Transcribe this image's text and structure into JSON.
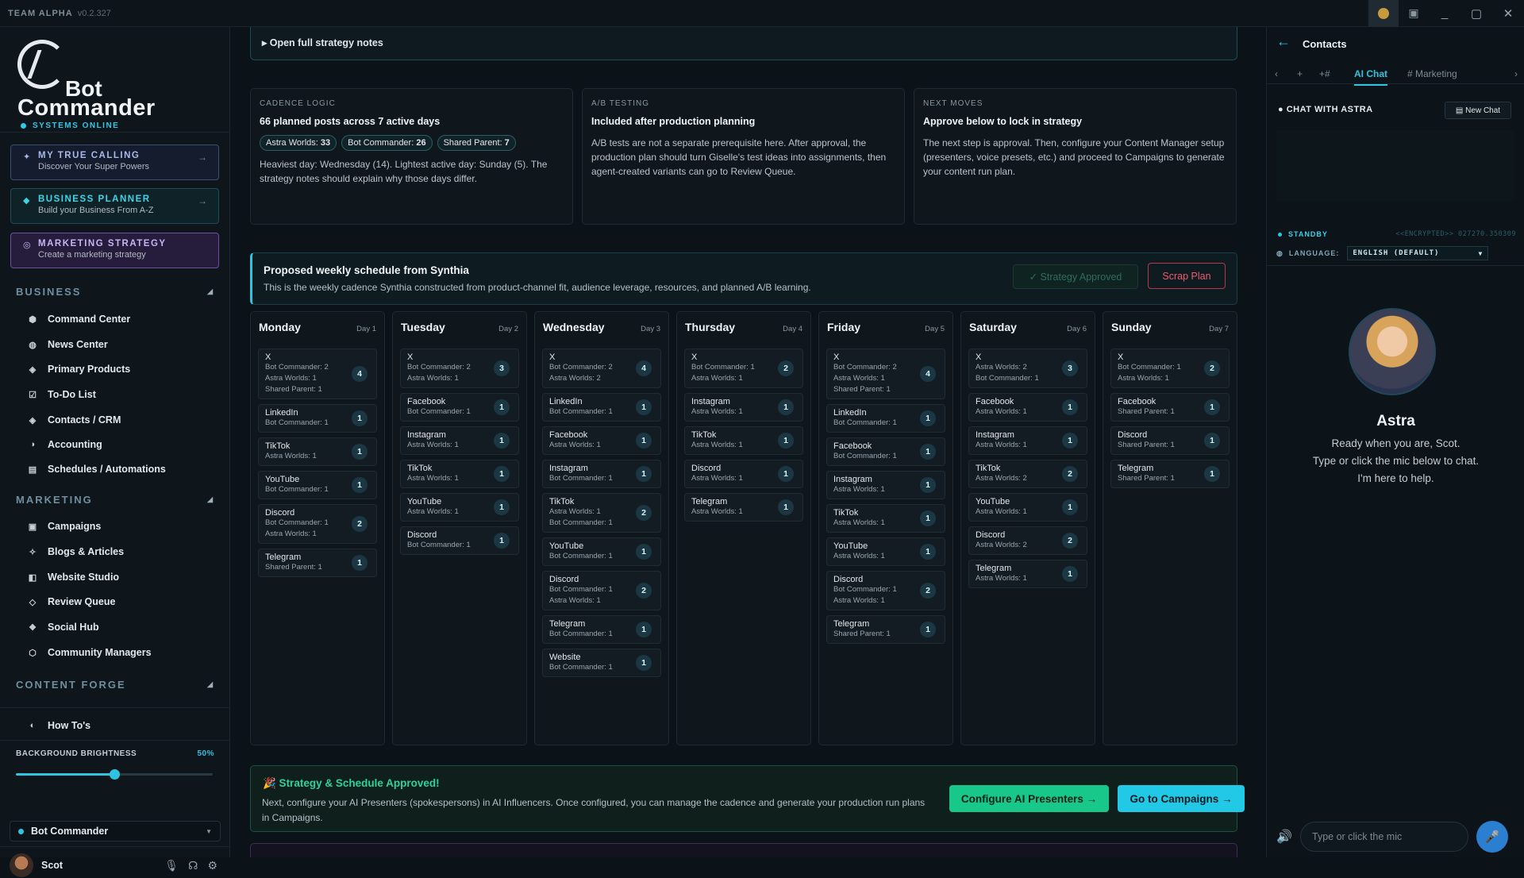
{
  "titlebar": {
    "app": "TEAM ALPHA",
    "version": "v0.2.327"
  },
  "sidebar": {
    "logo_line1": "Bot",
    "logo_line2": "Commander",
    "status": "SYSTEMS ONLINE",
    "ctas": [
      {
        "label": "MY TRUE CALLING",
        "sub": "Discover Your Super Powers"
      },
      {
        "label": "BUSINESS PLANNER",
        "sub": "Build your Business From A-Z"
      },
      {
        "label": "MARKETING STRATEGY",
        "sub": "Create a marketing strategy"
      }
    ],
    "sections": {
      "business": "BUSINESS",
      "marketing": "MARKETING",
      "content_forge": "CONTENT FORGE"
    },
    "business_items": [
      "Command Center",
      "News Center",
      "Primary Products",
      "To-Do List",
      "Contacts / CRM",
      "Accounting",
      "Schedules / Automations"
    ],
    "marketing_items": [
      "Campaigns",
      "Blogs & Articles",
      "Website Studio",
      "Review Queue",
      "Social Hub",
      "Community Managers"
    ],
    "forge_items": [
      "How To's"
    ],
    "brightness_label": "BACKGROUND BRIGHTNESS",
    "brightness_value": "50%",
    "brightness_fraction": 0.5,
    "workspace": "Bot Commander",
    "user": "Scot"
  },
  "main": {
    "notes_toggle": "Open full strategy notes",
    "cards": [
      {
        "kicker": "CADENCE LOGIC",
        "title": "66 planned posts across 7 active days",
        "chips": [
          [
            "Astra Worlds: ",
            "33"
          ],
          [
            "Bot Commander: ",
            "26"
          ],
          [
            "Shared Parent: ",
            "7"
          ]
        ],
        "text": "Heaviest day: Wednesday (14). Lightest active day: Sunday (5). The strategy notes should explain why those days differ."
      },
      {
        "kicker": "A/B TESTING",
        "title": "Included after production planning",
        "text": "A/B tests are not a separate prerequisite here. After approval, the production plan should turn Giselle's test ideas into assignments, then agent-created variants can go to Review Queue."
      },
      {
        "kicker": "NEXT MOVES",
        "title": "Approve below to lock in strategy",
        "text": "The next step is approval. Then, configure your Content Manager setup (presenters, voice presets, etc.) and proceed to Campaigns to generate your content run plan."
      }
    ],
    "schedule_title": "Proposed weekly schedule from Synthia",
    "schedule_sub": "This is the weekly cadence Synthia constructed from product-channel fit, audience leverage, resources, and planned A/B learning.",
    "approved_btn": "✓ Strategy Approved",
    "scrap_btn": "Scrap Plan",
    "days": [
      {
        "name": "Monday",
        "num": "Day 1",
        "posts": [
          {
            "ch": "X",
            "lines": [
              "Bot Commander: 2",
              "Astra Worlds: 1",
              "Shared Parent: 1"
            ],
            "count": "4"
          },
          {
            "ch": "LinkedIn",
            "lines": [
              "Bot Commander: 1"
            ],
            "count": "1"
          },
          {
            "ch": "TikTok",
            "lines": [
              "Astra Worlds: 1"
            ],
            "count": "1"
          },
          {
            "ch": "YouTube",
            "lines": [
              "Bot Commander: 1"
            ],
            "count": "1"
          },
          {
            "ch": "Discord",
            "lines": [
              "Bot Commander: 1",
              "Astra Worlds: 1"
            ],
            "count": "2"
          },
          {
            "ch": "Telegram",
            "lines": [
              "Shared Parent: 1"
            ],
            "count": "1"
          }
        ]
      },
      {
        "name": "Tuesday",
        "num": "Day 2",
        "posts": [
          {
            "ch": "X",
            "lines": [
              "Bot Commander: 2",
              "Astra Worlds: 1"
            ],
            "count": "3"
          },
          {
            "ch": "Facebook",
            "lines": [
              "Bot Commander: 1"
            ],
            "count": "1"
          },
          {
            "ch": "Instagram",
            "lines": [
              "Astra Worlds: 1"
            ],
            "count": "1"
          },
          {
            "ch": "TikTok",
            "lines": [
              "Astra Worlds: 1"
            ],
            "count": "1"
          },
          {
            "ch": "YouTube",
            "lines": [
              "Astra Worlds: 1"
            ],
            "count": "1"
          },
          {
            "ch": "Discord",
            "lines": [
              "Bot Commander: 1"
            ],
            "count": "1"
          }
        ]
      },
      {
        "name": "Wednesday",
        "num": "Day 3",
        "posts": [
          {
            "ch": "X",
            "lines": [
              "Bot Commander: 2",
              "Astra Worlds: 2"
            ],
            "count": "4"
          },
          {
            "ch": "LinkedIn",
            "lines": [
              "Bot Commander: 1"
            ],
            "count": "1"
          },
          {
            "ch": "Facebook",
            "lines": [
              "Astra Worlds: 1"
            ],
            "count": "1"
          },
          {
            "ch": "Instagram",
            "lines": [
              "Bot Commander: 1"
            ],
            "count": "1"
          },
          {
            "ch": "TikTok",
            "lines": [
              "Astra Worlds: 1",
              "Bot Commander: 1"
            ],
            "count": "2"
          },
          {
            "ch": "YouTube",
            "lines": [
              "Bot Commander: 1"
            ],
            "count": "1"
          },
          {
            "ch": "Discord",
            "lines": [
              "Bot Commander: 1",
              "Astra Worlds: 1"
            ],
            "count": "2"
          },
          {
            "ch": "Telegram",
            "lines": [
              "Bot Commander: 1"
            ],
            "count": "1"
          },
          {
            "ch": "Website",
            "lines": [
              "Bot Commander: 1"
            ],
            "count": "1"
          }
        ]
      },
      {
        "name": "Thursday",
        "num": "Day 4",
        "posts": [
          {
            "ch": "X",
            "lines": [
              "Bot Commander: 1",
              "Astra Worlds: 1"
            ],
            "count": "2"
          },
          {
            "ch": "Instagram",
            "lines": [
              "Astra Worlds: 1"
            ],
            "count": "1"
          },
          {
            "ch": "TikTok",
            "lines": [
              "Astra Worlds: 1"
            ],
            "count": "1"
          },
          {
            "ch": "Discord",
            "lines": [
              "Astra Worlds: 1"
            ],
            "count": "1"
          },
          {
            "ch": "Telegram",
            "lines": [
              "Astra Worlds: 1"
            ],
            "count": "1"
          }
        ]
      },
      {
        "name": "Friday",
        "num": "Day 5",
        "posts": [
          {
            "ch": "X",
            "lines": [
              "Bot Commander: 2",
              "Astra Worlds: 1",
              "Shared Parent: 1"
            ],
            "count": "4"
          },
          {
            "ch": "LinkedIn",
            "lines": [
              "Bot Commander: 1"
            ],
            "count": "1"
          },
          {
            "ch": "Facebook",
            "lines": [
              "Bot Commander: 1"
            ],
            "count": "1"
          },
          {
            "ch": "Instagram",
            "lines": [
              "Astra Worlds: 1"
            ],
            "count": "1"
          },
          {
            "ch": "TikTok",
            "lines": [
              "Astra Worlds: 1"
            ],
            "count": "1"
          },
          {
            "ch": "YouTube",
            "lines": [
              "Astra Worlds: 1"
            ],
            "count": "1"
          },
          {
            "ch": "Discord",
            "lines": [
              "Bot Commander: 1",
              "Astra Worlds: 1"
            ],
            "count": "2"
          },
          {
            "ch": "Telegram",
            "lines": [
              "Shared Parent: 1"
            ],
            "count": "1"
          }
        ]
      },
      {
        "name": "Saturday",
        "num": "Day 6",
        "posts": [
          {
            "ch": "X",
            "lines": [
              "Astra Worlds: 2",
              "Bot Commander: 1"
            ],
            "count": "3"
          },
          {
            "ch": "Facebook",
            "lines": [
              "Astra Worlds: 1"
            ],
            "count": "1"
          },
          {
            "ch": "Instagram",
            "lines": [
              "Astra Worlds: 1"
            ],
            "count": "1"
          },
          {
            "ch": "TikTok",
            "lines": [
              "Astra Worlds: 2"
            ],
            "count": "2"
          },
          {
            "ch": "YouTube",
            "lines": [
              "Astra Worlds: 1"
            ],
            "count": "1"
          },
          {
            "ch": "Discord",
            "lines": [
              "Astra Worlds: 2"
            ],
            "count": "2"
          },
          {
            "ch": "Telegram",
            "lines": [
              "Astra Worlds: 1"
            ],
            "count": "1"
          }
        ]
      },
      {
        "name": "Sunday",
        "num": "Day 7",
        "posts": [
          {
            "ch": "X",
            "lines": [
              "Bot Commander: 1",
              "Astra Worlds: 1"
            ],
            "count": "2"
          },
          {
            "ch": "Facebook",
            "lines": [
              "Shared Parent: 1"
            ],
            "count": "1"
          },
          {
            "ch": "Discord",
            "lines": [
              "Shared Parent: 1"
            ],
            "count": "1"
          },
          {
            "ch": "Telegram",
            "lines": [
              "Shared Parent: 1"
            ],
            "count": "1"
          }
        ]
      }
    ],
    "approved_title": "🎉 Strategy & Schedule Approved!",
    "approved_text": "Next, configure your AI Presenters (spokespersons) in AI Influencers. Once configured, you can manage the cadence and generate your production run plans in Campaigns.",
    "configure_btn": "Configure AI Presenters →",
    "campaigns_btn": "Go to Campaigns →"
  },
  "right": {
    "title": "Contacts",
    "tabs": [
      "AI Chat",
      "# Marketing"
    ],
    "chat_header": "CHAT WITH ASTRA",
    "new_chat": "New Chat",
    "standby": "STANDBY",
    "encrypted": "<<ENCRYPTED>> 027270.350309",
    "language_label": "LANGUAGE:",
    "language_value": "ENGLISH (DEFAULT)",
    "agent_name": "Astra",
    "agent_msg1": "Ready when you are, Scot.",
    "agent_msg2": "Type or click the mic below to chat.",
    "agent_msg3": "I'm here to help.",
    "input_placeholder": "Type or click the mic"
  }
}
